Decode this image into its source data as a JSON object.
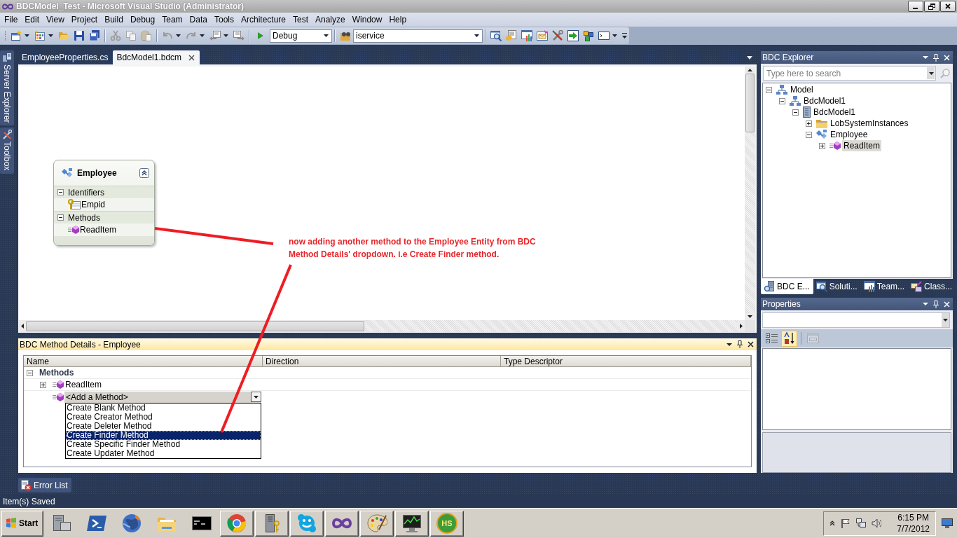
{
  "window": {
    "title": "BDCModel_Test - Microsoft Visual Studio (Administrator)"
  },
  "menu": [
    "File",
    "Edit",
    "View",
    "Project",
    "Build",
    "Debug",
    "Team",
    "Data",
    "Tools",
    "Architecture",
    "Test",
    "Analyze",
    "Window",
    "Help"
  ],
  "toolbar": {
    "configuration": "Debug",
    "find": "iservice"
  },
  "side_tabs": [
    "Server Explorer",
    "Toolbox"
  ],
  "document_tabs": [
    {
      "label": "EmployeeProperties.cs",
      "selected": false
    },
    {
      "label": "BdcModel1.bdcm",
      "selected": true
    }
  ],
  "designer": {
    "entity": {
      "name": "Employee",
      "sections": [
        {
          "title": "Identifiers",
          "expanded": true,
          "items": [
            {
              "label": "Empid",
              "kind": "identifier"
            }
          ]
        },
        {
          "title": "Methods",
          "expanded": true,
          "items": [
            {
              "label": "ReadItem",
              "kind": "method"
            }
          ]
        }
      ]
    },
    "annotation": {
      "lines": [
        "now adding another method to the Employee Entity from BDC",
        "Method Details' dropdown. i.e Create Finder method."
      ]
    }
  },
  "method_details": {
    "title": "BDC Method Details - Employee",
    "columns": [
      "Name",
      "Direction",
      "Type Descriptor"
    ],
    "group": {
      "label": "Methods",
      "expanded": true
    },
    "rows": [
      {
        "name": "ReadItem",
        "expanded": false
      }
    ],
    "add_method": {
      "value": "<Add a Method>",
      "options": [
        {
          "label": "Create Blank Method",
          "selected": false
        },
        {
          "label": "Create Creator Method",
          "selected": false
        },
        {
          "label": "Create Deleter Method",
          "selected": false
        },
        {
          "label": "Create Finder Method",
          "selected": true
        },
        {
          "label": "Create Specific Finder Method",
          "selected": false
        },
        {
          "label": "Create Updater Method",
          "selected": false
        }
      ]
    }
  },
  "bottom_tabs": [
    "Error List"
  ],
  "status_bar": "Item(s) Saved",
  "bdc_explorer": {
    "title": "BDC Explorer",
    "search": {
      "placeholder": "Type here to search"
    },
    "tree": [
      {
        "label": "Model",
        "kind": "model",
        "expanded": true,
        "selected": false,
        "children": [
          {
            "label": "BdcModel1",
            "kind": "model",
            "expanded": true,
            "selected": false,
            "children": [
              {
                "label": "BdcModel1",
                "kind": "system",
                "expanded": true,
                "selected": false,
                "children": [
                  {
                    "label": "LobSystemInstances",
                    "kind": "folder",
                    "expanded": false,
                    "selected": false
                  },
                  {
                    "label": "Employee",
                    "kind": "entity",
                    "expanded": true,
                    "selected": false,
                    "children": [
                      {
                        "label": "ReadItem",
                        "kind": "method",
                        "expanded": false,
                        "selected": true
                      }
                    ]
                  }
                ]
              }
            ]
          }
        ]
      }
    ]
  },
  "explorer_tabs": [
    {
      "label": "BDC E...",
      "selected": true
    },
    {
      "label": "Soluti...",
      "selected": false
    },
    {
      "label": "Team...",
      "selected": false
    },
    {
      "label": "Class...",
      "selected": false
    }
  ],
  "properties": {
    "title": "Properties",
    "tools": [
      {
        "kind": "categorized",
        "selected": false,
        "disabled": false
      },
      {
        "kind": "alphabetical",
        "selected": true,
        "disabled": false
      },
      {
        "kind": "property-pages",
        "selected": false,
        "disabled": true
      }
    ]
  },
  "taskbar": {
    "start": "Start",
    "apps": [
      {
        "running": false
      },
      {
        "running": false
      },
      {
        "running": false
      },
      {
        "running": false
      },
      {
        "running": false
      },
      {
        "running": true
      },
      {
        "running": true
      },
      {
        "running": true
      },
      {
        "running": true
      },
      {
        "running": true
      },
      {
        "running": true
      },
      {
        "running": true,
        "label": "HS"
      }
    ],
    "clock": {
      "time": "6:15 PM",
      "date": "7/7/2012"
    }
  }
}
